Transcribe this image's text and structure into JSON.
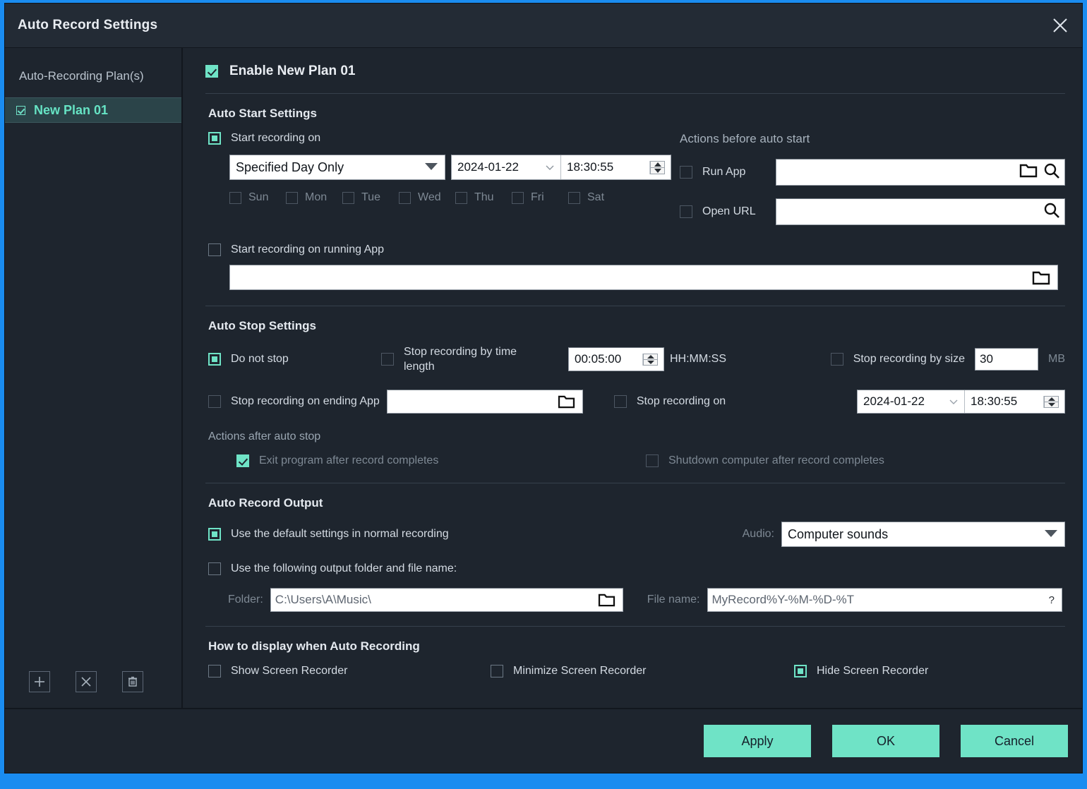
{
  "window": {
    "title": "Auto Record Settings",
    "close_icon": "close-icon"
  },
  "sidebar": {
    "header": "Auto-Recording Plan(s)",
    "plans": [
      {
        "label": "New Plan 01",
        "checked": true,
        "selected": true
      }
    ],
    "tools": [
      {
        "name": "add-plan-button",
        "icon": "plus-icon"
      },
      {
        "name": "remove-plan-button",
        "icon": "x-icon"
      },
      {
        "name": "delete-plan-button",
        "icon": "trash-icon"
      }
    ]
  },
  "main": {
    "enable": {
      "label": "Enable New Plan 01",
      "checked": true
    },
    "auto_start": {
      "title": "Auto Start Settings",
      "start_recording_on": {
        "label": "Start recording on",
        "selected": true
      },
      "schedule_mode": "Specified Day Only",
      "date": "2024-01-22",
      "time": "18:30:55",
      "days": [
        {
          "label": "Sun",
          "checked": false
        },
        {
          "label": "Mon",
          "checked": false
        },
        {
          "label": "Tue",
          "checked": false
        },
        {
          "label": "Wed",
          "checked": false
        },
        {
          "label": "Thu",
          "checked": false
        },
        {
          "label": "Fri",
          "checked": false
        },
        {
          "label": "Sat",
          "checked": false
        }
      ],
      "start_on_running_app": {
        "label": "Start recording on running App",
        "checked": false
      },
      "running_app_path": "",
      "actions_before": {
        "title": "Actions before auto start",
        "run_app": {
          "label": "Run App",
          "checked": false,
          "value": ""
        },
        "open_url": {
          "label": "Open URL",
          "checked": false,
          "value": ""
        }
      }
    },
    "auto_stop": {
      "title": "Auto Stop Settings",
      "do_not_stop": {
        "label": "Do not stop",
        "selected": true
      },
      "stop_by_time": {
        "label": "Stop recording by time length",
        "checked": false
      },
      "time_length": "00:05:00",
      "time_format_hint": "HH:MM:SS",
      "stop_by_size": {
        "label": "Stop recording by size",
        "checked": false
      },
      "size_value": "30",
      "size_unit": "MB",
      "stop_on_ending_app": {
        "label": "Stop recording on ending App",
        "checked": false,
        "value": ""
      },
      "stop_recording_on": {
        "label": "Stop recording on",
        "checked": false
      },
      "stop_date": "2024-01-22",
      "stop_time": "18:30:55",
      "actions_after": {
        "title": "Actions after auto stop",
        "exit_program": {
          "label": "Exit program after record completes",
          "checked": true
        },
        "shutdown": {
          "label": "Shutdown computer after record completes",
          "checked": false
        }
      }
    },
    "output": {
      "title": "Auto Record Output",
      "use_default": {
        "label": "Use the default settings in normal recording",
        "selected": true
      },
      "use_custom": {
        "label": "Use the following output folder and file name:",
        "checked": false
      },
      "audio_label": "Audio:",
      "audio_value": "Computer sounds",
      "folder_label": "Folder:",
      "folder_value": "C:\\Users\\A\\Music\\",
      "filename_label": "File name:",
      "filename_value": "MyRecord%Y-%M-%D-%T",
      "help_glyph": "?"
    },
    "display": {
      "title": "How to display when Auto Recording",
      "options": [
        {
          "label": "Show Screen Recorder",
          "selected": false
        },
        {
          "label": "Minimize Screen Recorder",
          "selected": false
        },
        {
          "label": "Hide Screen Recorder",
          "selected": true
        }
      ]
    }
  },
  "footer": {
    "apply": "Apply",
    "ok": "OK",
    "cancel": "Cancel"
  },
  "colors": {
    "accent": "#6fe3c6",
    "window_bg": "#1e252e",
    "titlebar_bg": "#232b35",
    "selected_plan_bg": "#2b4449",
    "desktop_blue": "#1a8cf0"
  }
}
